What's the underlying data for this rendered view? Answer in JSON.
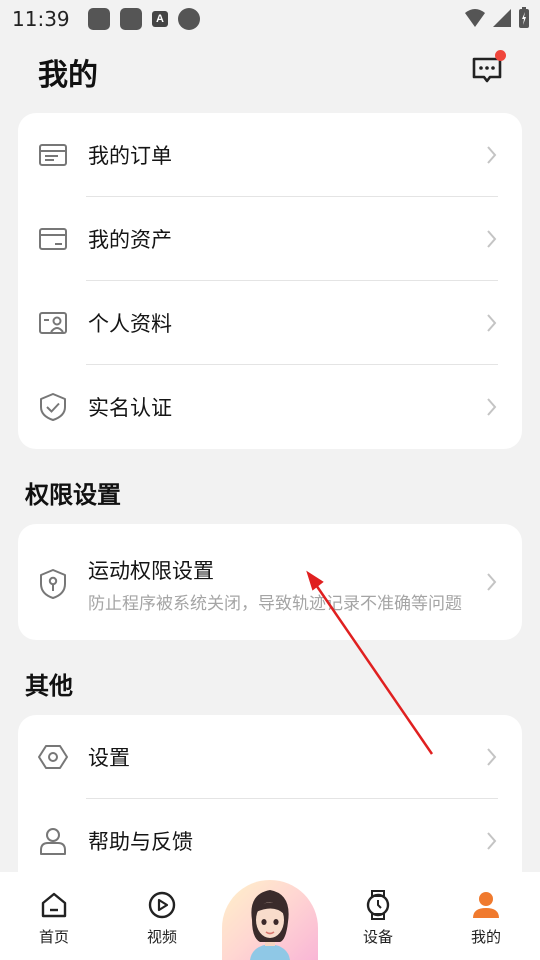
{
  "status": {
    "time": "11:39",
    "sim_badge": "A"
  },
  "header": {
    "title": "我的",
    "message_icon": "message-icon"
  },
  "account_menu": [
    {
      "label": "我的订单",
      "icon": "order-list-icon"
    },
    {
      "label": "我的资产",
      "icon": "wallet-card-icon"
    },
    {
      "label": "个人资料",
      "icon": "profile-card-icon"
    },
    {
      "label": "实名认证",
      "icon": "shield-check-icon"
    }
  ],
  "permission_section": {
    "title": "权限设置",
    "item": {
      "label": "运动权限设置",
      "subtitle": "防止程序被系统关闭，导致轨迹记录不准确等问题"
    }
  },
  "other_section": {
    "title": "其他",
    "items": [
      {
        "label": "设置",
        "icon": "hexagon-settings-icon"
      },
      {
        "label": "帮助与反馈",
        "icon": "person-help-icon"
      }
    ]
  },
  "tabbar": {
    "tabs": [
      {
        "label": "首页",
        "icon": "home-icon"
      },
      {
        "label": "视频",
        "icon": "play-circle-icon"
      },
      {
        "label": "设备",
        "icon": "watch-icon"
      },
      {
        "label": "我的",
        "icon": "person-icon",
        "active": true
      }
    ]
  },
  "colors": {
    "accent": "#f07a2e",
    "badge": "#f0463c",
    "annotation_arrow": "#e02020"
  }
}
